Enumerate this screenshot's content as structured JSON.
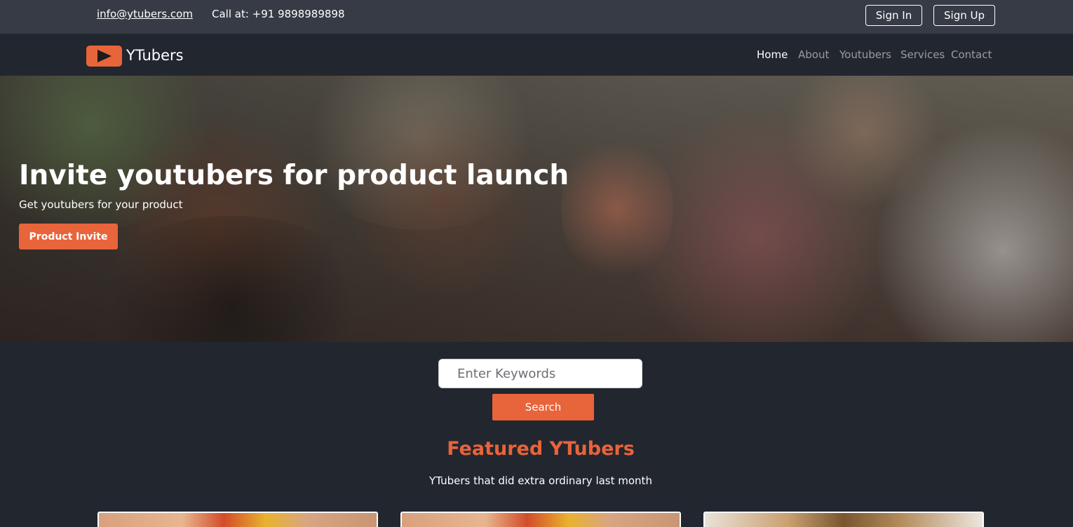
{
  "topbar": {
    "email": "info@ytubers.com",
    "phone": "Call at: +91 9898989898",
    "signin_label": "Sign In",
    "signup_label": "Sign Up"
  },
  "navbar": {
    "brand": "YTubers",
    "links": [
      {
        "label": "Home",
        "active": true
      },
      {
        "label": "About",
        "active": false
      },
      {
        "label": "Youtubers",
        "active": false
      },
      {
        "label": "Services",
        "active": false
      },
      {
        "label": "Contact",
        "active": false
      }
    ]
  },
  "hero": {
    "title": "Invite youtubers for product launch",
    "subtitle": "Get youtubers for your product",
    "button_label": "Product Invite"
  },
  "search": {
    "placeholder": "Enter Keywords",
    "button_label": "Search"
  },
  "featured": {
    "title": "Featured YTubers",
    "subtitle": "YTubers that did extra ordinary last month"
  },
  "colors": {
    "accent": "#e8643a",
    "topbar_bg": "#363b45",
    "page_bg": "#22262f"
  }
}
